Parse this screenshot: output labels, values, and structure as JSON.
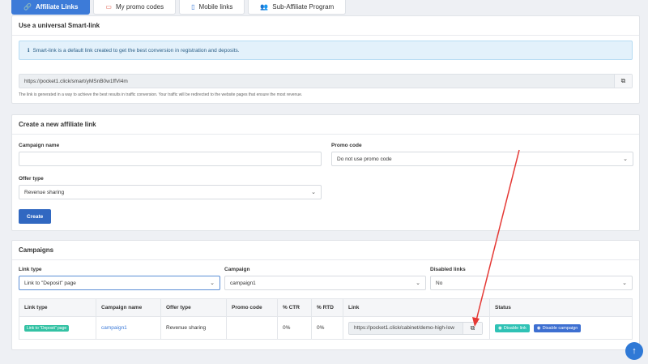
{
  "tabs": [
    {
      "label": "Affiliate Links",
      "icon": "link-icon"
    },
    {
      "label": "My promo codes",
      "icon": "ticket-icon"
    },
    {
      "label": "Mobile links",
      "icon": "mobile-icon"
    },
    {
      "label": "Sub-Affiliate Program",
      "icon": "users-icon"
    }
  ],
  "smartlink": {
    "title": "Use a universal Smart-link",
    "info": "Smart-link is a default link created to get the best conversion in registration and deposits.",
    "url": "https://pocket1.click/smart/yMSnB0w1ffVl4m",
    "hint": "The link is generated in a way to achieve the best results in traffic conversion. Your traffic will be redirected to the website pages that ensure the most revenue."
  },
  "create": {
    "title": "Create a new affiliate link",
    "campaign_name_label": "Campaign name",
    "campaign_name_value": "",
    "promo_code_label": "Promo code",
    "promo_code_value": "Do not use promo code",
    "offer_type_label": "Offer type",
    "offer_type_value": "Revenue sharing",
    "create_button": "Create"
  },
  "campaigns": {
    "title": "Campaigns",
    "filters": {
      "link_type_label": "Link type",
      "link_type_value": "Link to \"Deposit\" page",
      "campaign_label": "Campaign",
      "campaign_value": "campaign1",
      "disabled_label": "Disabled links",
      "disabled_value": "No"
    },
    "columns": [
      "Link type",
      "Campaign name",
      "Offer type",
      "Promo code",
      "% CTR",
      "% RTD",
      "Link",
      "Status"
    ],
    "rows": [
      {
        "link_type": "Link to \"Deposit\" page",
        "campaign_name": "campaign1",
        "offer_type": "Revenue sharing",
        "promo_code": "",
        "ctr": "0%",
        "rtd": "0%",
        "link": "https://pocket1.click/cabinet/demo-high-low",
        "disable_link": "Disable link",
        "disable_campaign": "Disable campaign"
      }
    ]
  },
  "colors": {
    "accent": "#3d7bd8",
    "primary_button": "#3168c1",
    "badge_teal": "#34c2a4",
    "annotation_arrow": "#e53935"
  }
}
